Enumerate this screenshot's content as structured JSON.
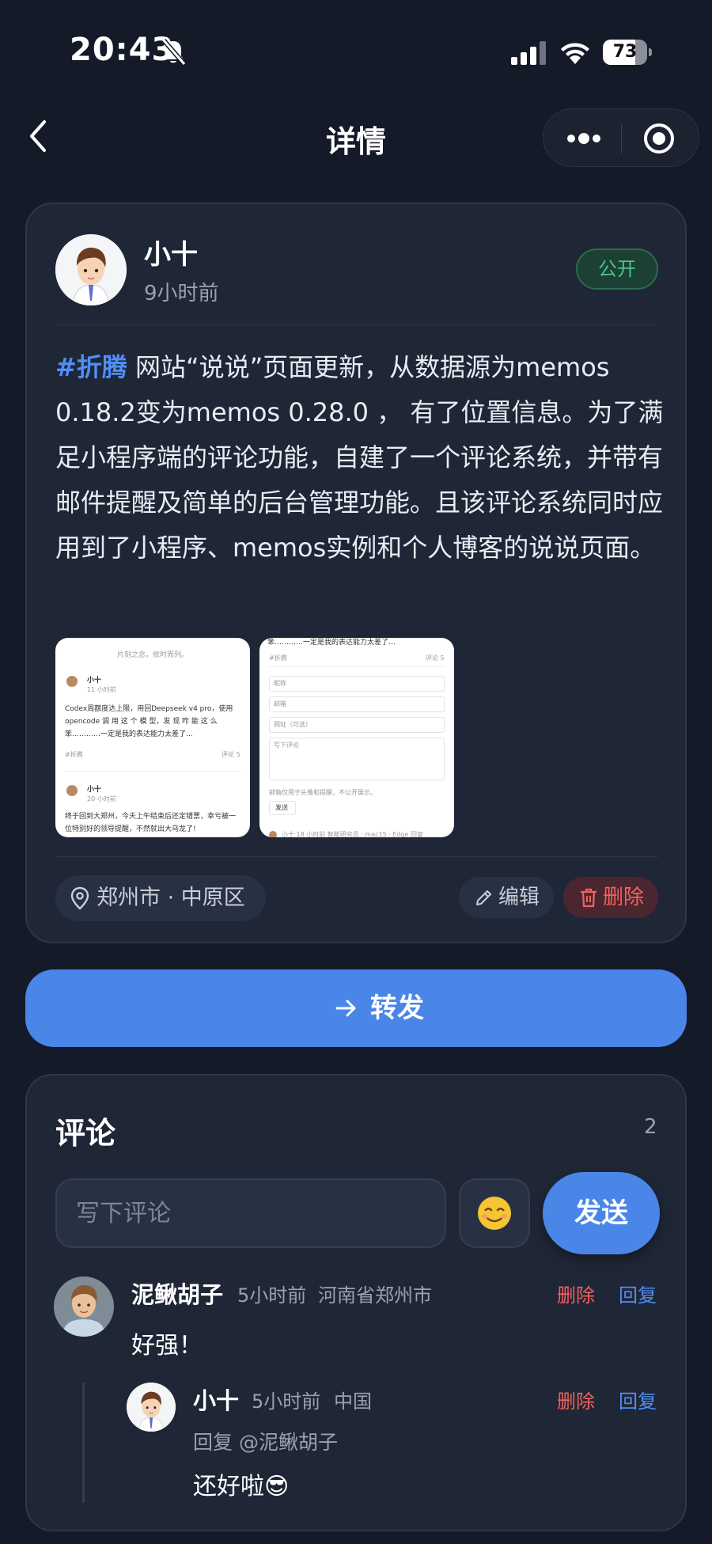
{
  "status_bar": {
    "time": "20:43",
    "battery_percent": 73
  },
  "nav": {
    "title": "详情"
  },
  "post": {
    "author": "小十",
    "time": "9小时前",
    "visibility": "公开",
    "tag": "#折腾",
    "content": " 网站“说说”页面更新，从数据源为memos 0.18.2变为memos 0.28.0 ， 有了位置信息。为了满足小程序端的评论功能，自建了一个评论系统，并带有邮件提醒及简单的后台管理功能。且该评论系统同时应用到了小程序、memos实例和个人博客的说说页面。",
    "location": "郑州市 · 中原区",
    "edit_label": "编辑",
    "delete_label": "删除",
    "thumb1": {
      "header": "片刻之念，依时而列。",
      "author1": "小十",
      "time1": "11 小时前",
      "text1": "Codex周额度达上限，用回Deepseek v4 pro，使用 opencode 调 用 这 个 模 型，发 现 咋 能 这 么 笨…………一定是我的表达能力太差了…",
      "tag1": "#折腾",
      "comments1": "评论 5",
      "author2": "小十",
      "time2": "20 小时前",
      "text2": "终于回到大郑州，今天上午结束后还定错票，幸亏被一位特别好的领导提醒，不然就出大乌龙了!"
    },
    "thumb2": {
      "top_text": "笨…………一定是我的表达能力太差了…",
      "tag": "#折腾",
      "comments": "评论 5",
      "field_nick": "昵称",
      "field_email": "邮箱",
      "field_url": "网址（可选）",
      "field_comment": "写下评论",
      "note": "邮箱仅用于头像和提醒，不公开展示。",
      "send": "发送",
      "footer": "小十 18 小时前 智能研究员 · mac15 · Edge 回复"
    }
  },
  "forward": {
    "label": "转发"
  },
  "comments": {
    "title": "评论",
    "count": "2",
    "input_placeholder": "写下评论",
    "emoji": "☺️",
    "send_label": "发送",
    "items": [
      {
        "name": "泥鳅胡子",
        "time": "5小时前",
        "location": "河南省郑州市",
        "delete_label": "删除",
        "reply_label": "回复",
        "text": "好强！",
        "replies": [
          {
            "name": "小十",
            "time": "5小时前",
            "location": "中国",
            "delete_label": "删除",
            "reply_label": "回复",
            "reply_to": "回复 @泥鳅胡子",
            "text": "还好啦😎"
          }
        ]
      }
    ]
  }
}
